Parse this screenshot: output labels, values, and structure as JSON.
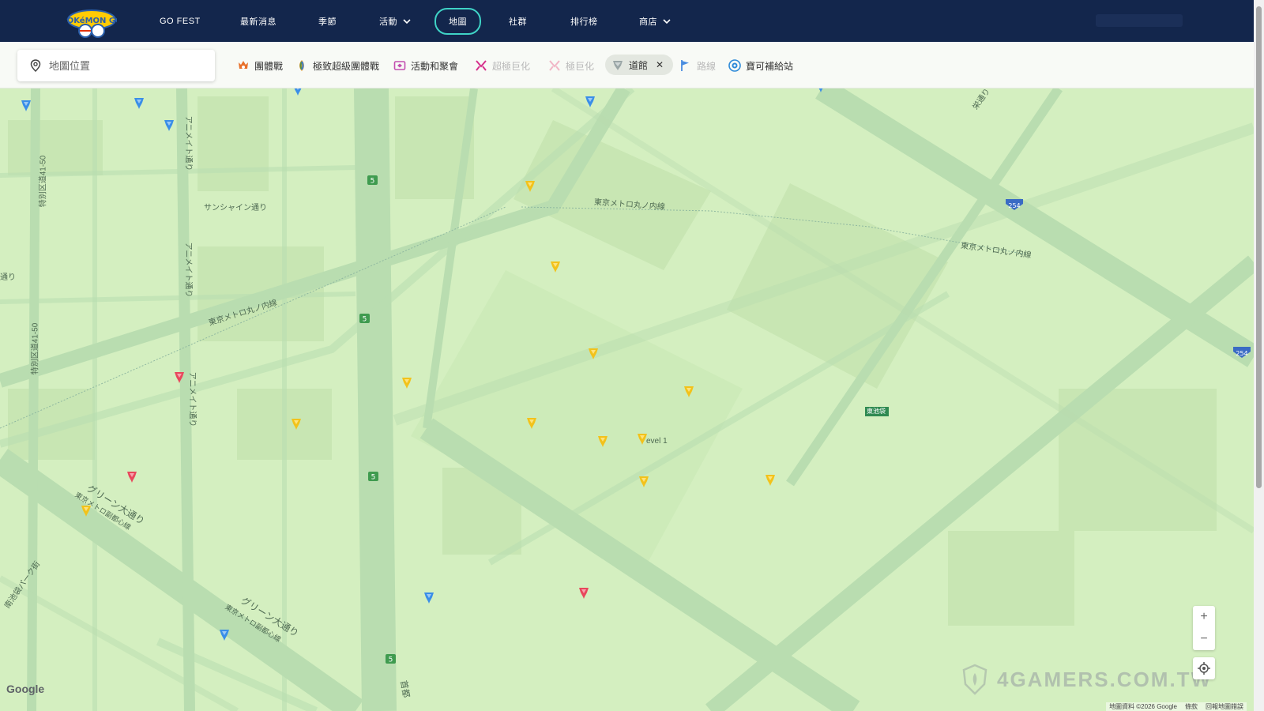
{
  "nav": {
    "logo_text": "POKéMON GO",
    "items": [
      {
        "label": "GO FEST"
      },
      {
        "label": "最新消息"
      },
      {
        "label": "季節"
      },
      {
        "label": "活動"
      },
      {
        "label": "地圖"
      },
      {
        "label": "社群"
      },
      {
        "label": "排行榜"
      },
      {
        "label": "商店"
      }
    ]
  },
  "search": {
    "placeholder": "地圖位置"
  },
  "filters": [
    {
      "label": "團體戰",
      "icon": "raid-icon",
      "state": "normal"
    },
    {
      "label": "極致超級團體戰",
      "icon": "mega-raid-icon",
      "state": "normal"
    },
    {
      "label": "活動和聚會",
      "icon": "event-icon",
      "state": "normal"
    },
    {
      "label": "超極巨化",
      "icon": "gigantamax-icon",
      "state": "dim"
    },
    {
      "label": "極巨化",
      "icon": "dynamax-icon",
      "state": "dim"
    },
    {
      "label": "道館",
      "icon": "gym-icon",
      "state": "selected"
    },
    {
      "label": "路線",
      "icon": "route-flag-icon",
      "state": "dim"
    },
    {
      "label": "寶可補給站",
      "icon": "pokestop-icon",
      "state": "normal"
    }
  ],
  "map": {
    "labels": [
      "サンシャイン通り",
      "東京メトロ丸ノ内線",
      "東京メトロ丸ノ内線",
      "東京メトロ丸ノ内線",
      "アニメイト通り",
      "アニメイト通り",
      "アニメイト通り",
      "特別区道41-50",
      "特別区道41-50",
      "グリーン大通り",
      "グリーン大通り",
      "東京メトロ副都心線",
      "東京メトロ副都心線",
      "南池袋パーク街",
      "通り",
      "evel 1",
      "東池袋",
      "首都",
      "栄通り"
    ],
    "route_shields": [
      "5",
      "5",
      "5",
      "5",
      "254",
      "254"
    ],
    "zoom_in": "+",
    "zoom_out": "−",
    "google": "Google",
    "attribution": [
      "地圖資料 ©2026 Google",
      "條款",
      "回報地圖錯誤"
    ],
    "watermark": "4GAMERS.COM.TW"
  },
  "colors": {
    "nav_bg": "#13264c",
    "active_outline": "#3fd3c6",
    "map_bg": "#d4efc0",
    "gym_yellow": "#f2c21b",
    "gym_blue": "#3a8ee8",
    "gym_red": "#e8475c"
  }
}
